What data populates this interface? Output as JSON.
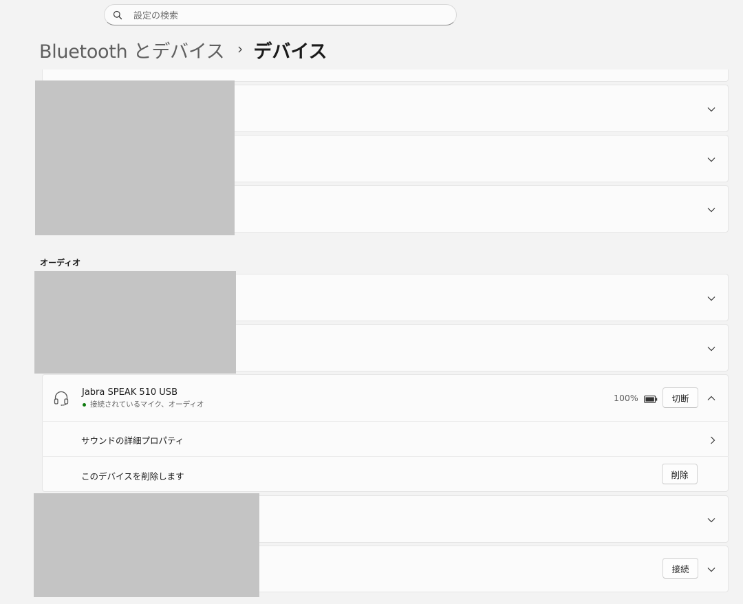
{
  "search": {
    "placeholder": "設定の検索",
    "icon": "search-icon"
  },
  "breadcrumb": {
    "parent": "Bluetooth とデバイス",
    "current": "デバイス"
  },
  "audio_section": {
    "label": "オーディオ"
  },
  "expanded_device": {
    "name": "Jabra SPEAK 510 USB",
    "status": "接続されているマイク、オーディオ",
    "status_color": "#0f7b0f",
    "battery": "100%",
    "disconnect_label": "切断",
    "icon": "headset-icon"
  },
  "device_options": [
    {
      "label": "サウンドの詳細プロパティ",
      "icon": "chevron-right-icon"
    },
    {
      "label": "このデバイスを削除します",
      "button_label": "削除"
    }
  ],
  "connect_label": "接続",
  "colors": {
    "background": "#f3f3f3",
    "card": "#fbfbfb",
    "redaction": "#c4c4c4"
  }
}
